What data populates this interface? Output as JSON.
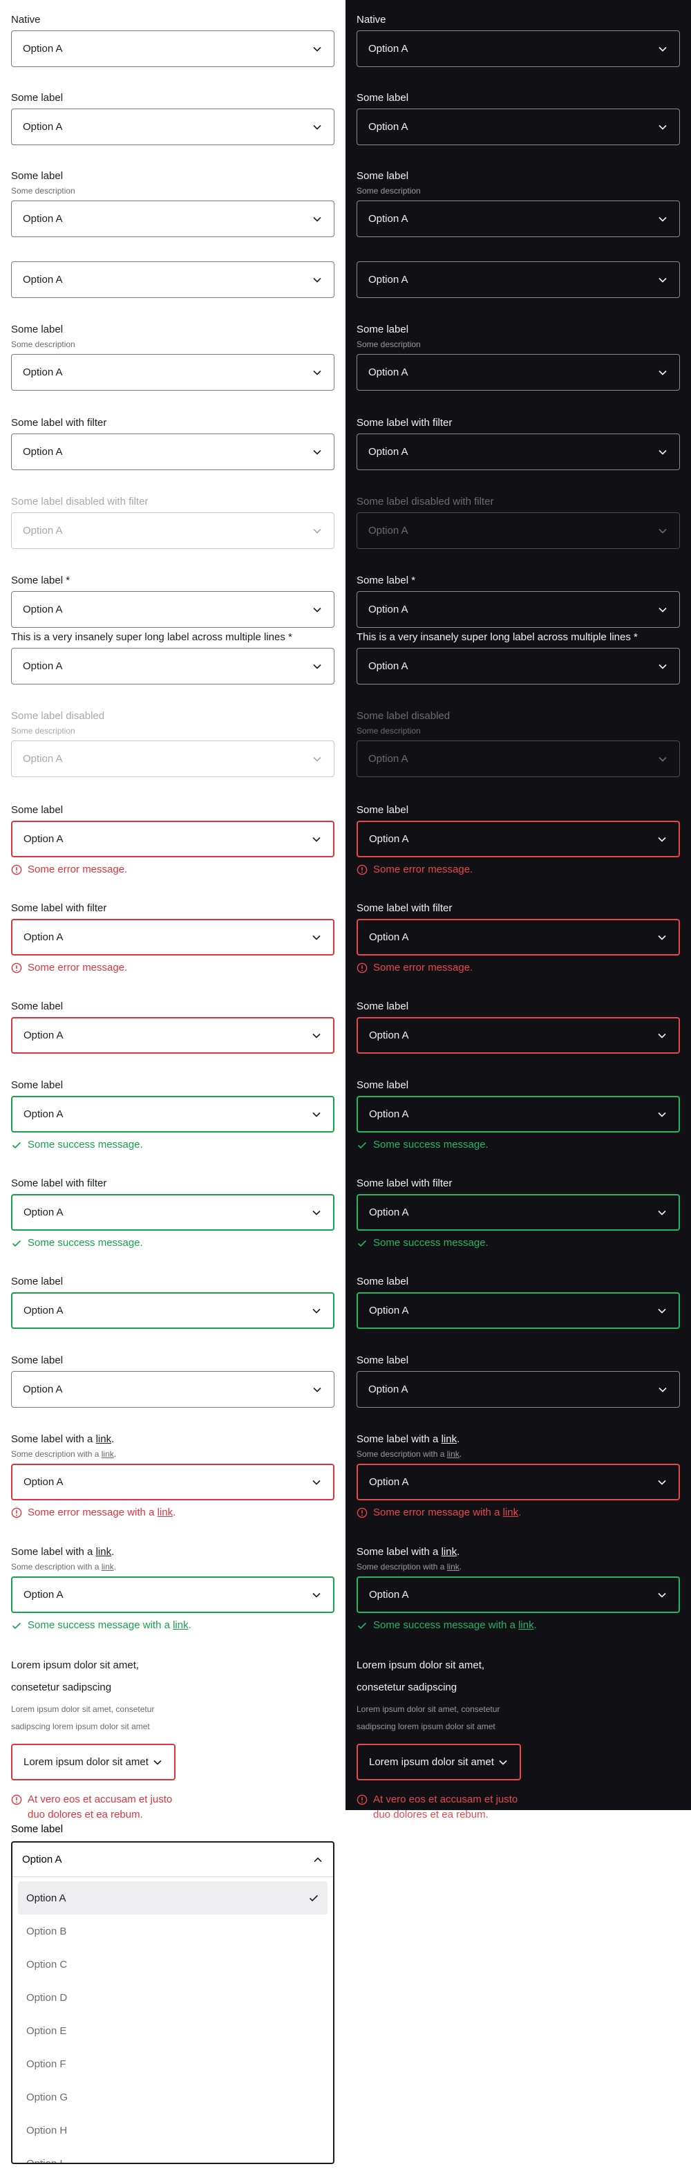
{
  "option": "Option A",
  "labels": {
    "native": "Native",
    "some_label": "Some label",
    "description": "Some description",
    "with_filter": "Some label with filter",
    "disabled_filter": "Some label disabled with filter",
    "required": "Some label *",
    "long": "This is a very insanely super long label across multiple lines *",
    "disabled": "Some label disabled",
    "with_a": "Some label with a ",
    "desc_with_a": "Some description with a ",
    "link": "link",
    "dot": ".",
    "lorem1": "Lorem ipsum dolor sit amet,",
    "lorem2": "consetetur sadipscing",
    "lorem_desc1": "Lorem ipsum dolor sit amet, consetetur",
    "lorem_desc2": "sadipscing lorem ipsum dolor sit amet"
  },
  "messages": {
    "error": "Some error message.",
    "success": "Some success message.",
    "error_link": "Some error message with a ",
    "success_link": "Some success message with a ",
    "lorem_value": "Lorem ipsum dolor sit amet",
    "lorem_err1": "At vero eos et accusam et justo",
    "lorem_err2": "duo dolores et ea rebum."
  },
  "dropdown": {
    "label": "Some label",
    "selected": "Option A",
    "options": [
      "Option A",
      "Option B",
      "Option C",
      "Option D",
      "Option E",
      "Option F",
      "Option G",
      "Option H",
      "Option I"
    ]
  },
  "colors": {
    "dark_bg": "#111014",
    "error": "#e0343b",
    "success": "#15a34a"
  }
}
